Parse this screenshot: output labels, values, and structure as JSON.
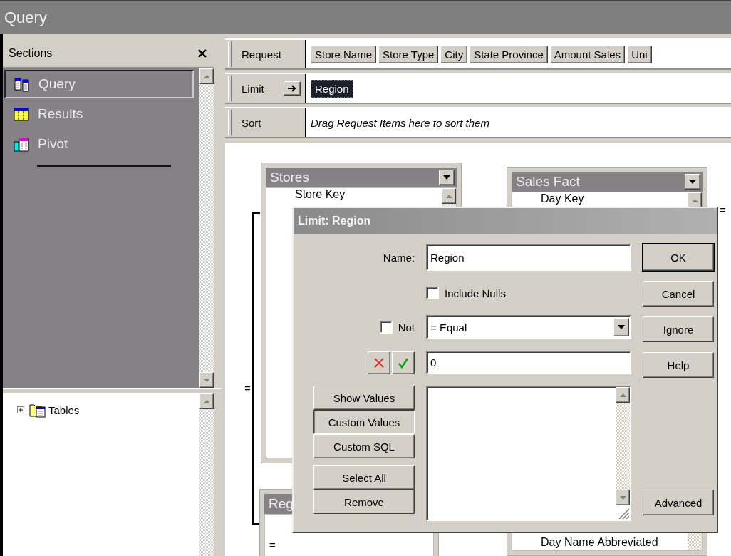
{
  "window": {
    "title": "Query"
  },
  "sections_panel": {
    "title": "Sections",
    "items": [
      {
        "label": "Query",
        "kind": "query",
        "selected": true
      },
      {
        "label": "Results",
        "kind": "results",
        "selected": false
      },
      {
        "label": "Pivot",
        "kind": "pivot",
        "selected": false
      }
    ]
  },
  "tree": {
    "items": [
      {
        "label": "Tables",
        "expanded": false
      }
    ]
  },
  "request_bar": {
    "label": "Request",
    "items": [
      "Store Name",
      "Store Type",
      "City",
      "State Province",
      "Amount Sales",
      "Uni"
    ]
  },
  "limit_bar": {
    "label": "Limit",
    "items": [
      {
        "label": "Region",
        "selected": true
      }
    ]
  },
  "sort_bar": {
    "label": "Sort",
    "placeholder": "Drag Request Items here to sort them"
  },
  "canvas": {
    "tables": [
      {
        "title": "Stores",
        "fields": [
          "Store Key"
        ]
      },
      {
        "title": "Sales Fact",
        "fields": [
          "Day Key",
          "Day Name Abbreviated"
        ]
      },
      {
        "title": "Reg"
      }
    ],
    "join_labels": [
      "=",
      "=",
      "="
    ]
  },
  "dialog": {
    "title": "Limit: Region",
    "name_label": "Name:",
    "name_value": "Region",
    "include_nulls": {
      "label": "Include Nulls",
      "checked": false
    },
    "not": {
      "label": "Not",
      "checked": false
    },
    "operator": "= Equal",
    "value": "0",
    "mode_buttons": [
      {
        "label": "Show Values",
        "selected": false
      },
      {
        "label": "Custom Values",
        "selected": true
      },
      {
        "label": "Custom SQL",
        "selected": false
      }
    ],
    "list_buttons": [
      "Select All",
      "Remove"
    ],
    "side_buttons": [
      {
        "label": "OK",
        "default": true
      },
      {
        "label": "Cancel",
        "default": false
      },
      {
        "label": "Ignore",
        "default": false
      },
      {
        "label": "Help",
        "default": false
      }
    ],
    "advanced_button": "Advanced"
  }
}
